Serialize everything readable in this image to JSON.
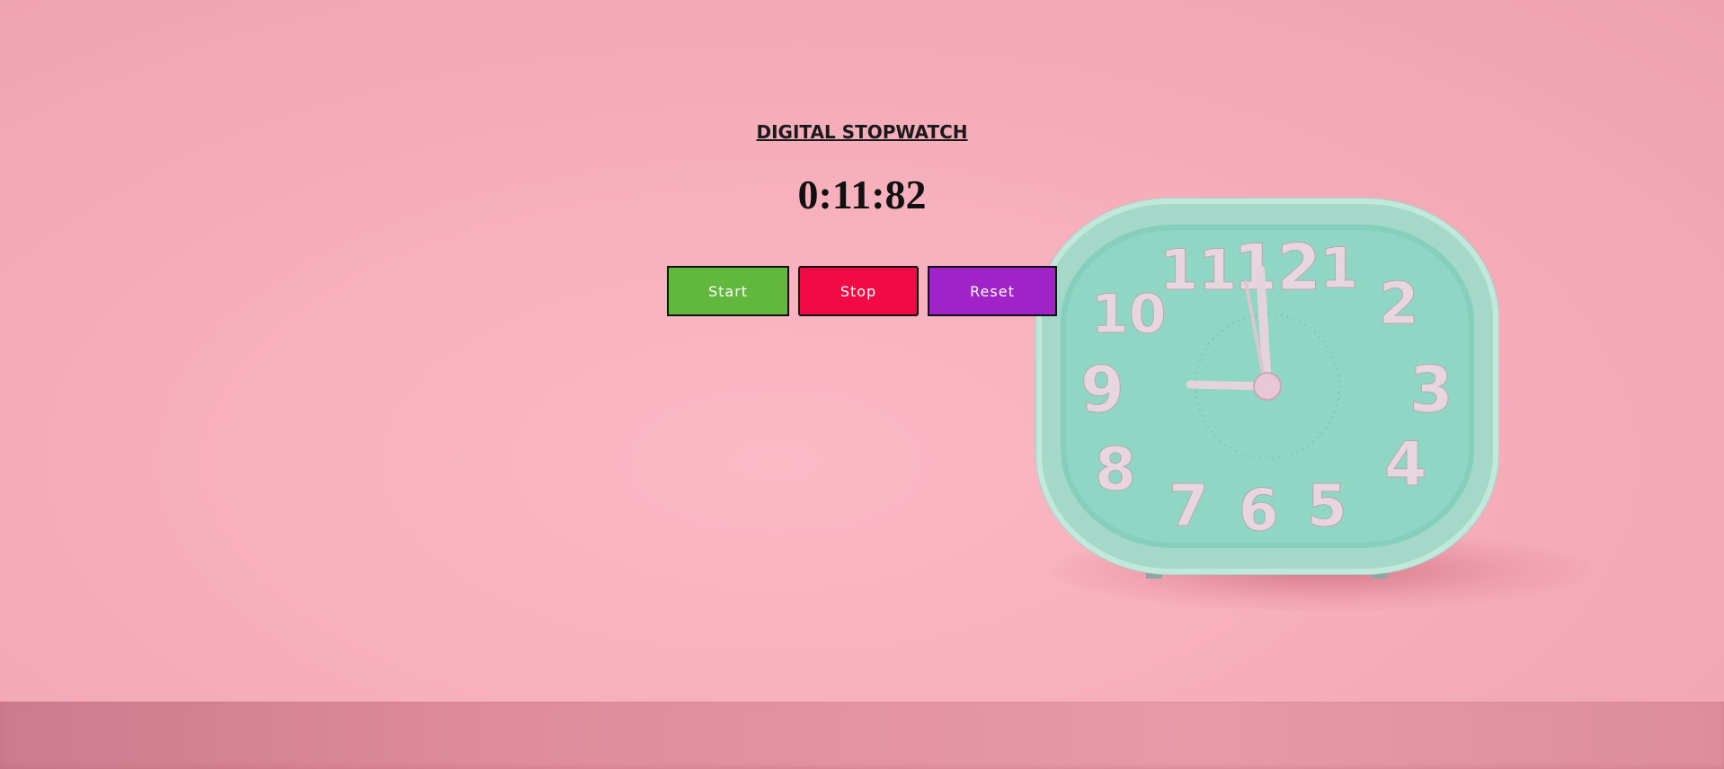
{
  "stopwatch": {
    "title": "DIGITAL STOPWATCH",
    "time": "0:11:82"
  },
  "buttons": {
    "start_label": "Start",
    "stop_label": "Stop",
    "reset_label": "Reset"
  },
  "colors": {
    "start": "#62b83c",
    "stop": "#f20a45",
    "reset": "#a023c7",
    "background": "#f7b0bd",
    "clock_body": "#a9dccd",
    "clock_face": "#8fd3c2",
    "clock_numerals": "#e7d6de"
  },
  "background_image": {
    "icon": "alarm-clock-photo",
    "numerals": [
      "12",
      "1",
      "2",
      "3",
      "4",
      "5",
      "6",
      "7",
      "8",
      "9",
      "10",
      "11"
    ]
  }
}
